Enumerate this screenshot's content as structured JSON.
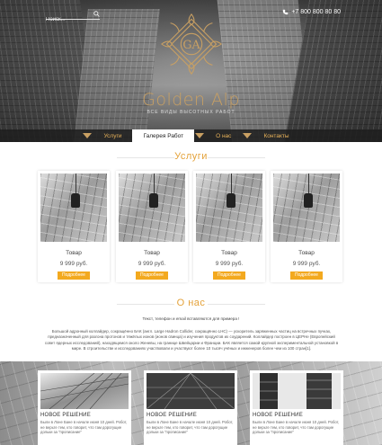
{
  "header": {
    "search_placeholder": "Поиск...",
    "phone": "+7 800 800 80 80",
    "logo_letters": "GA",
    "brand": "Golden Alp",
    "tagline": "ВСЕ ВИДЫ ВЫСОТНЫХ РАБОТ"
  },
  "nav": {
    "items": [
      {
        "label": "Услуги"
      },
      {
        "label": "Галерея Работ"
      },
      {
        "label": "О нас"
      },
      {
        "label": "Контакты"
      }
    ]
  },
  "services": {
    "title": "Услуги",
    "products": [
      {
        "name": "Товар",
        "price": "9 999 руб.",
        "button": "Подробнее"
      },
      {
        "name": "Товар",
        "price": "9 999 руб.",
        "button": "Подробнее"
      },
      {
        "name": "Товар",
        "price": "9 999 руб.",
        "button": "Подробнее"
      },
      {
        "name": "Товар",
        "price": "9 999 руб.",
        "button": "Подробнее"
      }
    ]
  },
  "about": {
    "title": "О нас",
    "intro": "Текст, телефон и email вставляются для примера !",
    "text": "Большой адронный коллайдер, сокращённо БАК (англ. Large Hadron Collider, сокращённо LHC) — ускоритель заряженных частиц на встречных пучках, предназначенный для разгона протонов и тяжёлых ионов (ионов свинца) и изучения продуктов их соударений. Коллайдер построен в ЦЕРНе (Европейский совет ядерных исследований), находящемся около Женевы, на границе Швейцарии и Франции. БАК является самой крупной экспериментальной установкой в мире. В строительстве и исследованиях участвовали и участвуют более 10 тысяч учёных и инженеров более чем из 100 стран[1]."
  },
  "news": [
    {
      "title": "НОВОЕ РЕШЕНИЕ",
      "text": "Были в Лоне Бане в начале июня 10 дней. Робот, не верьте тем, кто говорит, что там дорогущие дольки за \"прописание\""
    },
    {
      "title": "НОВОЕ РЕШЕНИЕ",
      "text": "Были в Лоне Бане в начале июня 10 дней. Робот, не верьте тем, кто говорит, что там дорогущие дольки за \"прописание\""
    },
    {
      "title": "НОВОЕ РЕШЕНИЕ",
      "text": "Были в Лоне Бане в начале июня 10 дней. Робот, не верьте тем, кто говорит, что там дорогущие дольки за \"прописание\""
    }
  ],
  "colors": {
    "accent": "#e4a23a",
    "gold": "#c9a063",
    "button": "#f3a91f",
    "nav_bg": "#1e1e1e"
  }
}
